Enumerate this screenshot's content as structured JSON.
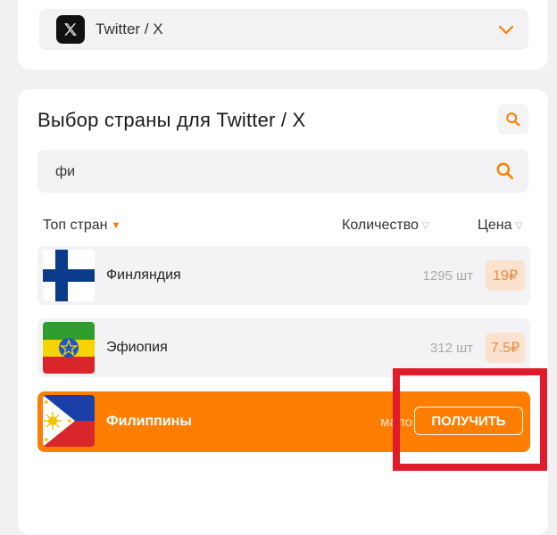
{
  "service": {
    "name": "Twitter / X"
  },
  "main": {
    "title": "Выбор страны для Twitter / X",
    "search": {
      "value": "фи"
    },
    "columns": {
      "top": "Топ стран",
      "quantity": "Количество",
      "price": "Цена"
    },
    "rows": [
      {
        "country": "Финляндия",
        "quantity": "1295 шт",
        "price": "19₽"
      },
      {
        "country": "Эфиопия",
        "quantity": "312 шт",
        "price": "7.5₽"
      },
      {
        "country": "Филиппины",
        "quantity": "мало",
        "button": "ПОЛУЧИТЬ"
      }
    ]
  },
  "colors": {
    "accent": "#ff7d00",
    "price_bg": "#fbe2cf",
    "highlight": "#e01b2a"
  }
}
